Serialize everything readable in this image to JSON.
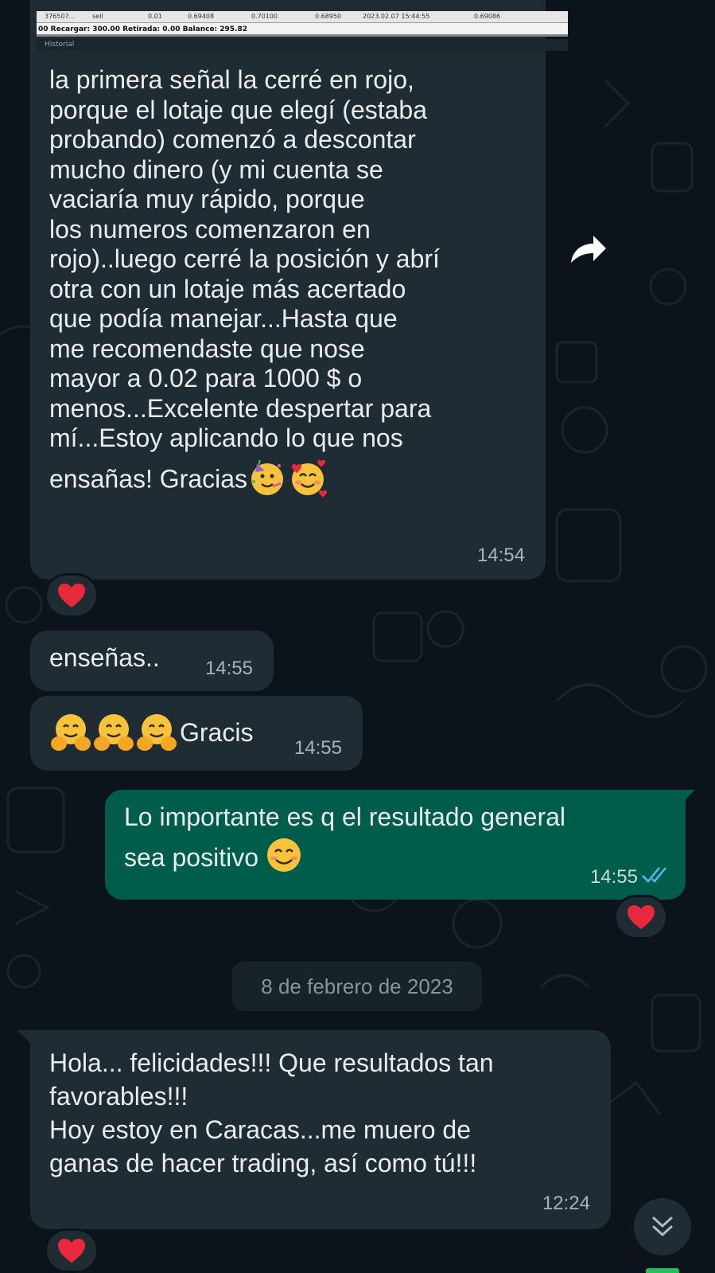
{
  "quoted_screenshot": {
    "row1": [
      "376507...",
      "sell",
      "0.01",
      "0.69408",
      "0.70100",
      "0.68950",
      "2023.02.07 15:44:55",
      "0.69086"
    ],
    "row2": "00 Recargar: 300.00  Retirada: 0.00  Balance: 295.82",
    "row3": "Historial"
  },
  "messages": [
    {
      "direction": "in",
      "lines": [
        "la primera señal la cerré en rojo,",
        "porque el lotaje que elegí (estaba",
        "probando) comenzó a descontar",
        "mucho dinero (y mi cuenta se",
        "vaciaría muy rápido, porque",
        "los numeros comenzaron en",
        "rojo)..luego cerré la posición y abrí",
        "otra con un lotaje más acertado",
        "que podía manejar...Hasta que",
        "me recomendaste que nose",
        "mayor a 0.02 para 1000 $ o",
        "menos...Excelente despertar para",
        "mí...Estoy aplicando lo que nos",
        "ensañas! Gracias"
      ],
      "time": "14:54",
      "reaction": "❤️"
    },
    {
      "direction": "in",
      "text": "enseñas..",
      "time": "14:55"
    },
    {
      "direction": "in",
      "text": "Gracis",
      "time": "14:55"
    },
    {
      "direction": "out",
      "lines": [
        "Lo importante es q el resultado general",
        "sea positivo"
      ],
      "time": "14:55",
      "reaction": "❤️",
      "status": "read"
    },
    {
      "direction": "in",
      "lines": [
        "Hola... felicidades!!! Que resultados tan",
        "favorables!!!",
        "Hoy estoy en Caracas...me muero de",
        "ganas de hacer trading, así como tú!!!"
      ],
      "time": "12:24",
      "reaction": "❤️"
    }
  ],
  "date_separator": "8 de febrero de 2023",
  "icons": [
    "forward-icon",
    "scroll-down-icon",
    "read-receipt-icon",
    "heart-reaction-icon",
    "party-face-emoji",
    "smiling-hearts-emoji",
    "hugging-face-emoji",
    "smiling-face-emoji"
  ],
  "colors": {
    "background": "#0b141a",
    "incoming_bubble": "#202c33",
    "outgoing_bubble": "#005c4b",
    "read_receipt": "#53bdeb",
    "heart": "#e8283c"
  }
}
